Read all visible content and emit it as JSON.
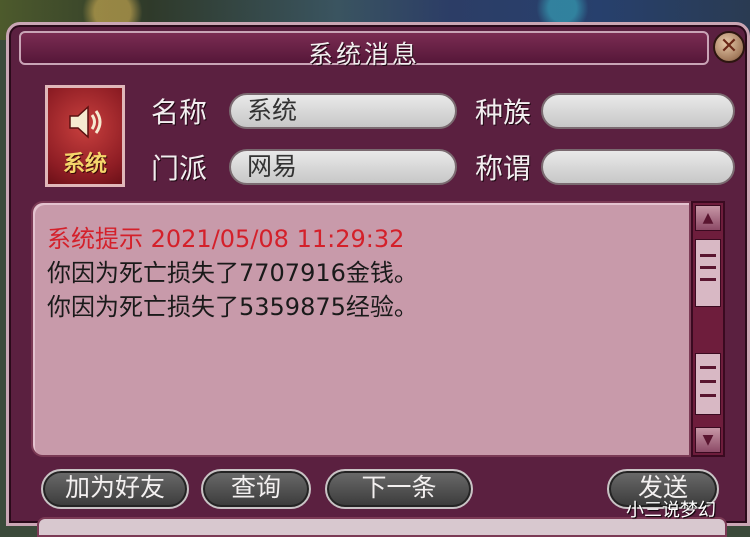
{
  "window": {
    "title": "系统消息",
    "close_label": "⊗"
  },
  "avatar": {
    "icon": "speaker-icon",
    "label": "系统"
  },
  "fields": {
    "name_label": "名称",
    "name_value": "系统",
    "race_label": "种族",
    "race_value": "",
    "sect_label": "门派",
    "sect_value": "网易",
    "title_label": "称谓",
    "title_value": ""
  },
  "message": {
    "header": "系统提示 2021/05/08 11:29:32",
    "lines": [
      "你因为死亡损失了7707916金钱。",
      "你因为死亡损失了5359875经验。"
    ]
  },
  "buttons": {
    "add_friend": "加为好友",
    "query": "查询",
    "next": "下一条",
    "send": "发送"
  },
  "watermark": "小三说梦幻",
  "colors": {
    "frame": "#5b2040",
    "message_bg": "#c89aaa",
    "header_text": "#d4202a"
  }
}
